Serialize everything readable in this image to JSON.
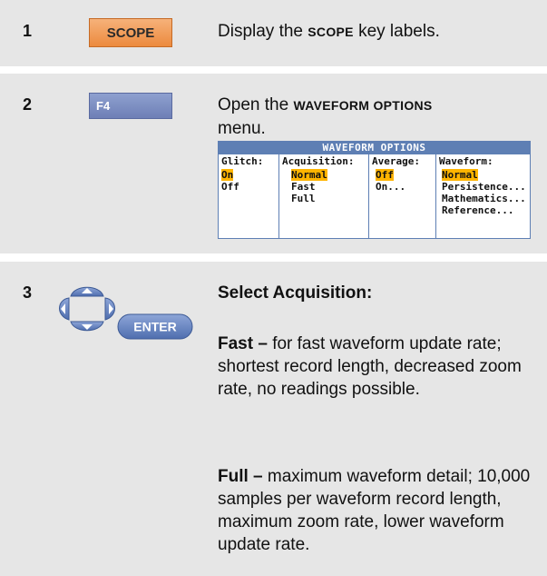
{
  "steps": [
    {
      "number": "1",
      "key_label": "SCOPE",
      "text_before": "Display the ",
      "text_key": "SCOPE",
      "text_after": " key labels."
    },
    {
      "number": "2",
      "key_label": "F4",
      "text_before": "Open the ",
      "text_key": "WAVEFORM OPTIONS",
      "text_line2": "menu."
    },
    {
      "number": "3",
      "key_label": "ENTER",
      "intro_bold": "Select Acquisition:",
      "fast_label": "Fast –",
      "fast_text": " for fast waveform update rate; shortest record length, decreased zoom rate, no readings possible.",
      "full_label": "Full –",
      "full_text": " maximum waveform detail; 10,000 samples per waveform record length, maximum zoom rate, lower waveform update rate."
    }
  ],
  "menu": {
    "title": "WAVEFORM OPTIONS",
    "columns": [
      {
        "header": "Glitch:",
        "options": [
          "On",
          "Off"
        ],
        "selected": 0
      },
      {
        "header": "Acquisition:",
        "options": [
          "Normal",
          "Fast",
          "Full"
        ],
        "selected": 0
      },
      {
        "header": "Average:",
        "options": [
          "Off",
          "On..."
        ],
        "selected": 0
      },
      {
        "header": "Waveform:",
        "options": [
          "Normal",
          "Persistence...",
          "Mathematics...",
          "Reference..."
        ],
        "selected": 0
      }
    ]
  },
  "colors": {
    "row_background": "#e6e6e6",
    "scope_key": "#ec8a3e",
    "function_key": "#6e7fb6",
    "menu_accent": "#5e7fb4",
    "selection": "#ffb400",
    "nav_pad": "#5c7ab8"
  }
}
